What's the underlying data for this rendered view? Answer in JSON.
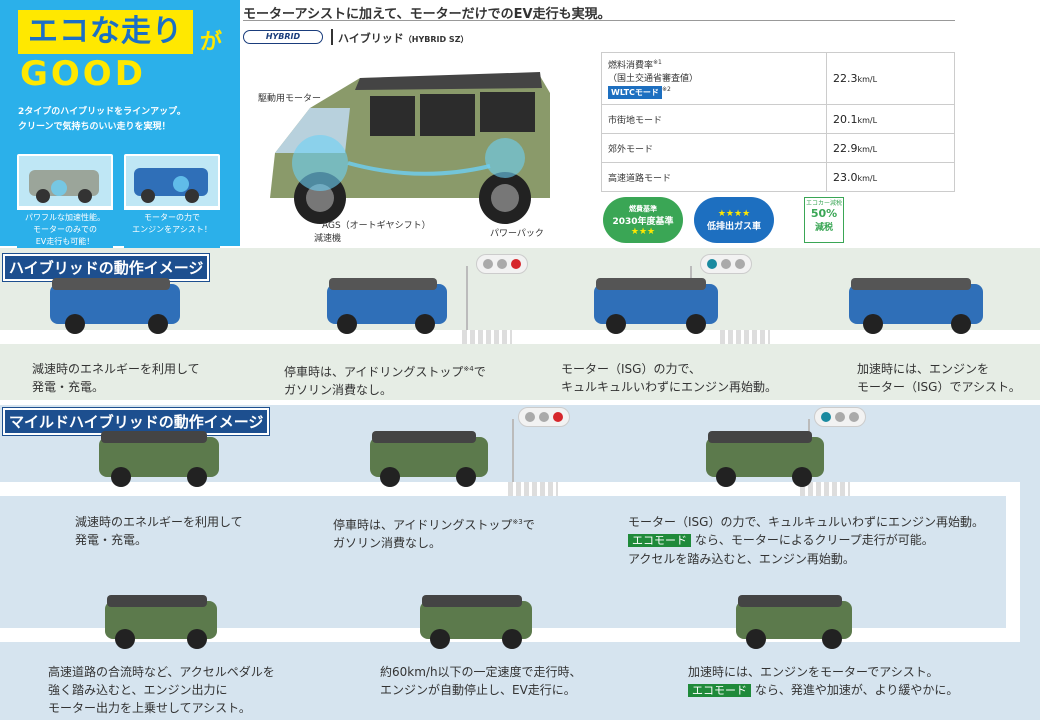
{
  "left_panel": {
    "title": "エコな走り",
    "ga": "が",
    "good": "GOOD",
    "lead1": "2タイプのハイブリッドをラインアップ。",
    "lead2": "クリーンで気持ちのいい走りを実現！",
    "thumb1": [
      "パワフルな加速性能。",
      "モーターのみでの",
      "EV走行も可能！"
    ],
    "thumb2": [
      "モーターの力で",
      "エンジンをアシスト！"
    ]
  },
  "header": {
    "headline": "モーターアシストに加えて、モーターだけでのEV走行も実現。",
    "logo": "HYBRID",
    "name": "ハイブリッド",
    "name_sub": "（HYBRID SZ）"
  },
  "car_labels": {
    "motor": "駆動用モーター",
    "ags": "AGS（オートギヤシフト）",
    "reducer": "減速機",
    "pack": "パワーパック"
  },
  "spec": {
    "rows": [
      {
        "label": "燃料消費率",
        "sup": "※1",
        "label2": "（国土交通省審査値）",
        "wltc": "WLTCモード",
        "wsup": "※2",
        "value": "22.3",
        "unit": "km/L"
      },
      {
        "label": "市街地モード",
        "value": "20.1",
        "unit": "km/L"
      },
      {
        "label": "郊外モード",
        "value": "22.9",
        "unit": "km/L"
      },
      {
        "label": "高速道路モード",
        "value": "23.0",
        "unit": "km/L"
      }
    ]
  },
  "badges": {
    "b1": [
      "燃費基準",
      "2030年度基準",
      "★★★"
    ],
    "b2": [
      "★★★★",
      "低排出ガス車"
    ],
    "b3": [
      "エコカー減税",
      "50%",
      "減税"
    ]
  },
  "section1": {
    "title": "ハイブリッドの動作イメージ",
    "d1": [
      "減速時のエネルギーを利用して",
      "発電・充電。"
    ],
    "d2": [
      "停車時は、アイドリングストップ",
      "※4",
      "で",
      "ガソリン消費なし。"
    ],
    "d3": [
      "モーター（ISG）の力で、",
      "キュルキュルいわずにエンジン再始動。"
    ],
    "d4": [
      "加速時には、エンジンを",
      "モーター（ISG）でアシスト。"
    ]
  },
  "section2": {
    "title": "マイルドハイブリッドの動作イメージ",
    "d1": [
      "減速時のエネルギーを利用して",
      "発電・充電。"
    ],
    "d2": [
      "停車時は、アイドリングストップ",
      "※3",
      "で",
      "ガソリン消費なし。"
    ],
    "d3": [
      "モーター（ISG）の力で、キュルキュルいわずにエンジン再始動。",
      "エコモード",
      "なら、モーターによるクリープ走行が可能。",
      "アクセルを踏み込むと、エンジン再始動。"
    ],
    "d4": [
      "高速道路の合流時など、アクセルペダルを",
      "強く踏み込むと、エンジン出力に",
      "モーター出力を上乗せしてアシスト。"
    ],
    "d5": [
      "約60km/h以下の一定速度で走行時、",
      "エンジンが自動停止し、EV走行に。"
    ],
    "d6": [
      "加速時には、エンジンをモーターでアシスト。",
      "エコモード",
      "なら、発進や加速が、より緩やかに。"
    ]
  },
  "colors": {
    "blue_car": "#2f6fb8",
    "green_car": "#5c7a4c",
    "accent": "#2bb0ea",
    "yellow": "#ffe800"
  }
}
